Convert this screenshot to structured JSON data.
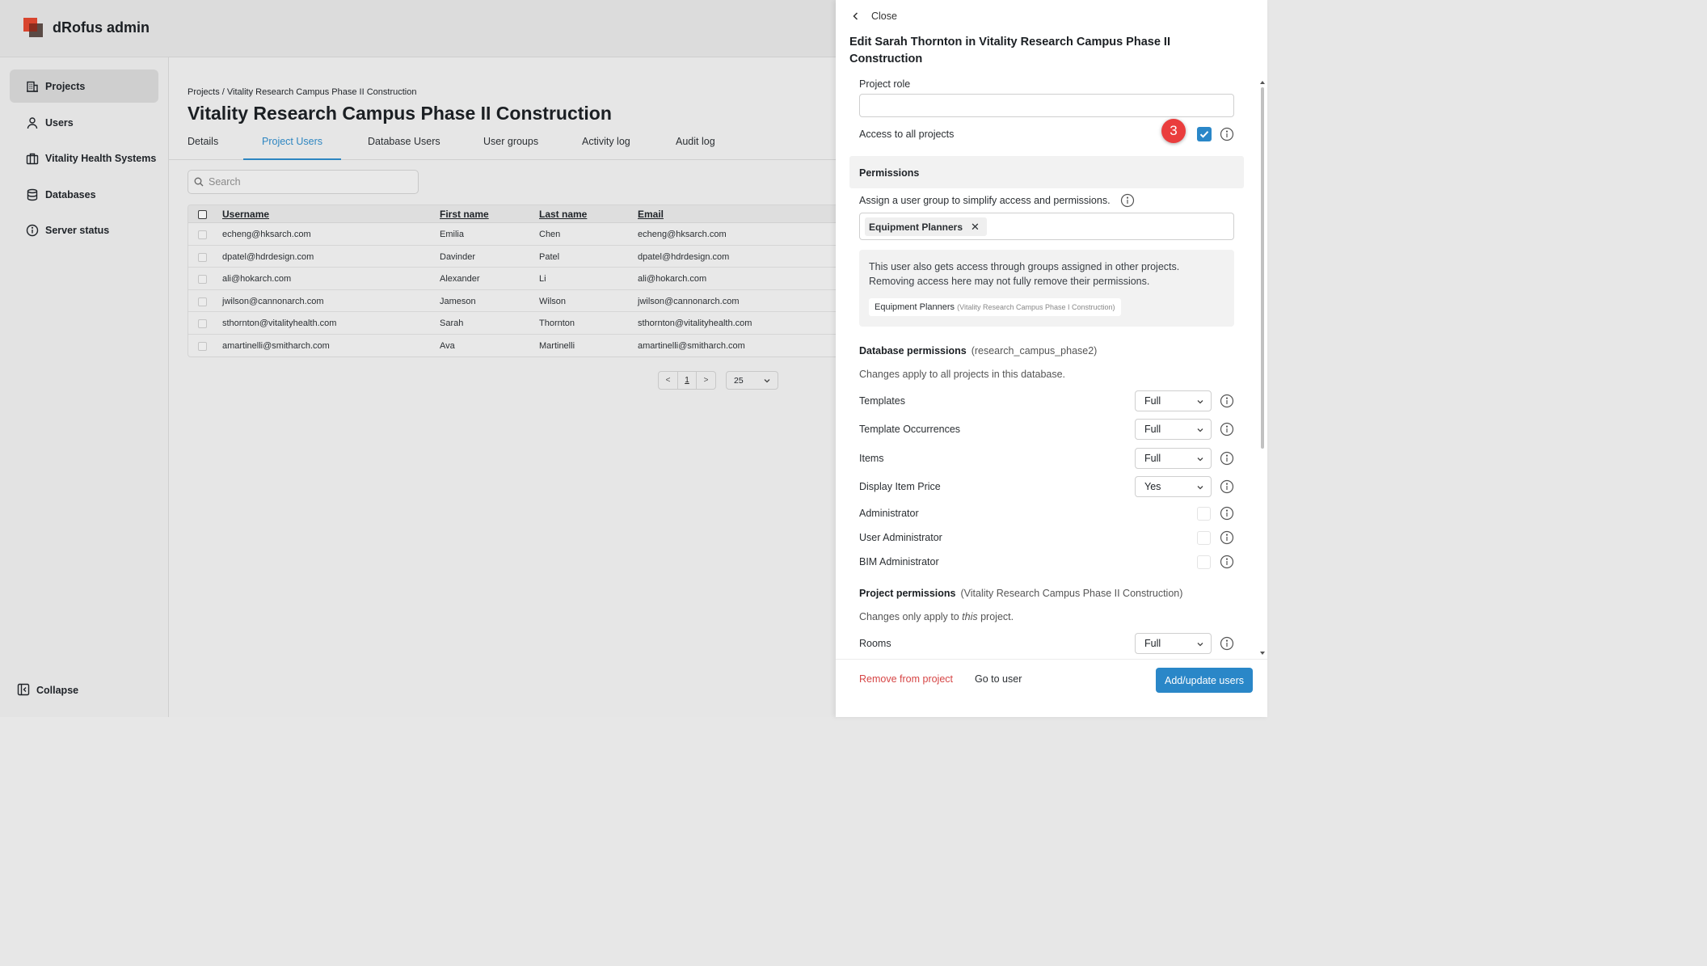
{
  "app": {
    "title": "dRofus admin"
  },
  "sidebar": {
    "items": [
      {
        "label": "Projects",
        "icon": "building-icon",
        "active": true
      },
      {
        "label": "Users",
        "icon": "user-icon"
      },
      {
        "label": "Vitality Health Systems",
        "icon": "briefcase-icon"
      },
      {
        "label": "Databases",
        "icon": "database-icon"
      },
      {
        "label": "Server status",
        "icon": "info-icon"
      }
    ],
    "collapse_label": "Collapse"
  },
  "main": {
    "breadcrumb": "Projects / Vitality Research Campus Phase II Construction",
    "title": "Vitality Research Campus Phase II Construction",
    "tabs": [
      "Details",
      "Project Users",
      "Database Users",
      "User groups",
      "Activity log",
      "Audit log"
    ],
    "active_tab": "Project Users",
    "search_placeholder": "Search",
    "table": {
      "columns": [
        "Username",
        "First name",
        "Last name",
        "Email"
      ],
      "rows": [
        [
          "echeng@hksarch.com",
          "Emilia",
          "Chen",
          "echeng@hksarch.com"
        ],
        [
          "dpatel@hdrdesign.com",
          "Davinder",
          "Patel",
          "dpatel@hdrdesign.com"
        ],
        [
          "ali@hokarch.com",
          "Alexander",
          "Li",
          "ali@hokarch.com"
        ],
        [
          "jwilson@cannonarch.com",
          "Jameson",
          "Wilson",
          "jwilson@cannonarch.com"
        ],
        [
          "sthornton@vitalityhealth.com",
          "Sarah",
          "Thornton",
          "sthornton@vitalityhealth.com"
        ],
        [
          "amartinelli@smitharch.com",
          "Ava",
          "Martinelli",
          "amartinelli@smitharch.com"
        ]
      ]
    },
    "pagination": {
      "prev": "<",
      "page": "1",
      "next": ">",
      "page_size": "25"
    }
  },
  "drawer": {
    "close_label": "Close",
    "title": "Edit Sarah Thornton in Vitality Research Campus Phase II Construction",
    "project_role_label": "Project role",
    "project_role_value": "",
    "access_all_label": "Access to all projects",
    "access_all_checked": true,
    "step_badge": "3",
    "permissions_header": "Permissions",
    "group_hint": "Assign a user group to simplify access and permissions.",
    "group_chip": "Equipment Planners",
    "notice_text": "This user also gets access through groups assigned in other projects. Removing access here may not fully remove their permissions.",
    "notice_chip_name": "Equipment Planners",
    "notice_chip_project": "(Vitality Research Campus Phase I Construction)",
    "db_permissions_title": "Database permissions",
    "db_permissions_sub": "(research_campus_phase2)",
    "db_permissions_note": "Changes apply to all projects in this database.",
    "db_selects": [
      {
        "label": "Templates",
        "value": "Full"
      },
      {
        "label": "Template Occurrences",
        "value": "Full"
      },
      {
        "label": "Items",
        "value": "Full"
      },
      {
        "label": "Display Item Price",
        "value": "Yes"
      }
    ],
    "db_checks": [
      {
        "label": "Administrator",
        "checked": false
      },
      {
        "label": "User Administrator",
        "checked": false
      },
      {
        "label": "BIM Administrator",
        "checked": false
      }
    ],
    "project_permissions_title": "Project permissions",
    "project_permissions_sub": "(Vitality Research Campus Phase II Construction)",
    "project_permissions_note_prefix": "Changes only apply to ",
    "project_permissions_note_em": "this",
    "project_permissions_note_suffix": " project.",
    "project_selects": [
      {
        "label": "Rooms",
        "value": "Full"
      }
    ],
    "remove_label": "Remove from project",
    "goto_label": "Go to user",
    "submit_label": "Add/update users"
  },
  "colors": {
    "accent": "#2a87c8",
    "danger": "#d64545",
    "badge": "#ea3d3d",
    "logo_red": "#d8452e"
  }
}
